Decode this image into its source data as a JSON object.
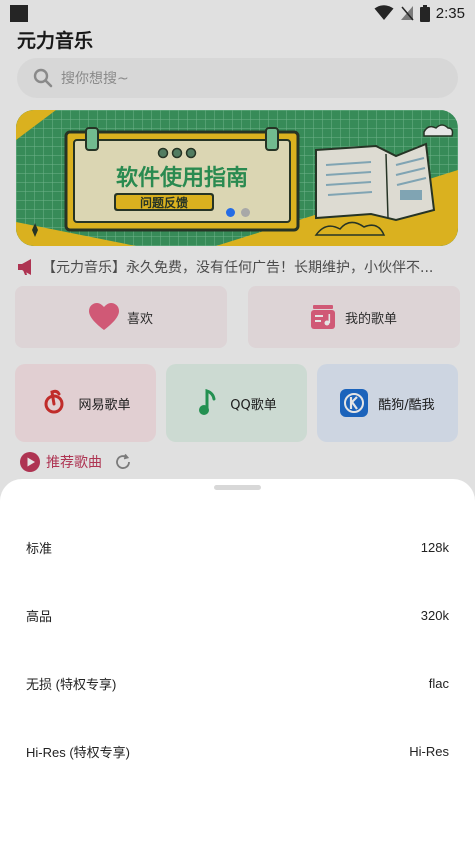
{
  "status_bar": {
    "time": "2:35"
  },
  "app": {
    "title": "元力音乐"
  },
  "search": {
    "placeholder": "搜你想搜~"
  },
  "banner": {
    "headline": "软件使用指南",
    "button": "问题反馈",
    "page_count": 2,
    "active_page": 1
  },
  "notice": {
    "text": "【元力音乐】永久免费，没有任何广告！长期维护，小伙伴不..."
  },
  "quick_actions": [
    {
      "label": "喜欢",
      "icon": "heart-icon"
    },
    {
      "label": "我的歌单",
      "icon": "playlist-icon"
    }
  ],
  "sources": [
    {
      "label": "网易歌单",
      "icon": "netease-icon",
      "bg": "#fbe7ea"
    },
    {
      "label": "QQ歌单",
      "icon": "qqmusic-icon",
      "bg": "#e4f3ea"
    },
    {
      "label": "酷狗/酷我",
      "icon": "kugou-icon",
      "bg": "#e5eefb"
    }
  ],
  "recommend": {
    "label": "推荐歌曲"
  },
  "quality_sheet": {
    "options": [
      {
        "name": "标准",
        "value": "128k"
      },
      {
        "name": "高品",
        "value": "320k"
      },
      {
        "name": "无损 (特权专享)",
        "value": "flac"
      },
      {
        "name": "Hi-Res (特权专享)",
        "value": "Hi-Res"
      }
    ]
  },
  "colors": {
    "accent": "#c23a5c",
    "banner_green": "#3e9b63",
    "banner_yellow": "#f3c623"
  }
}
